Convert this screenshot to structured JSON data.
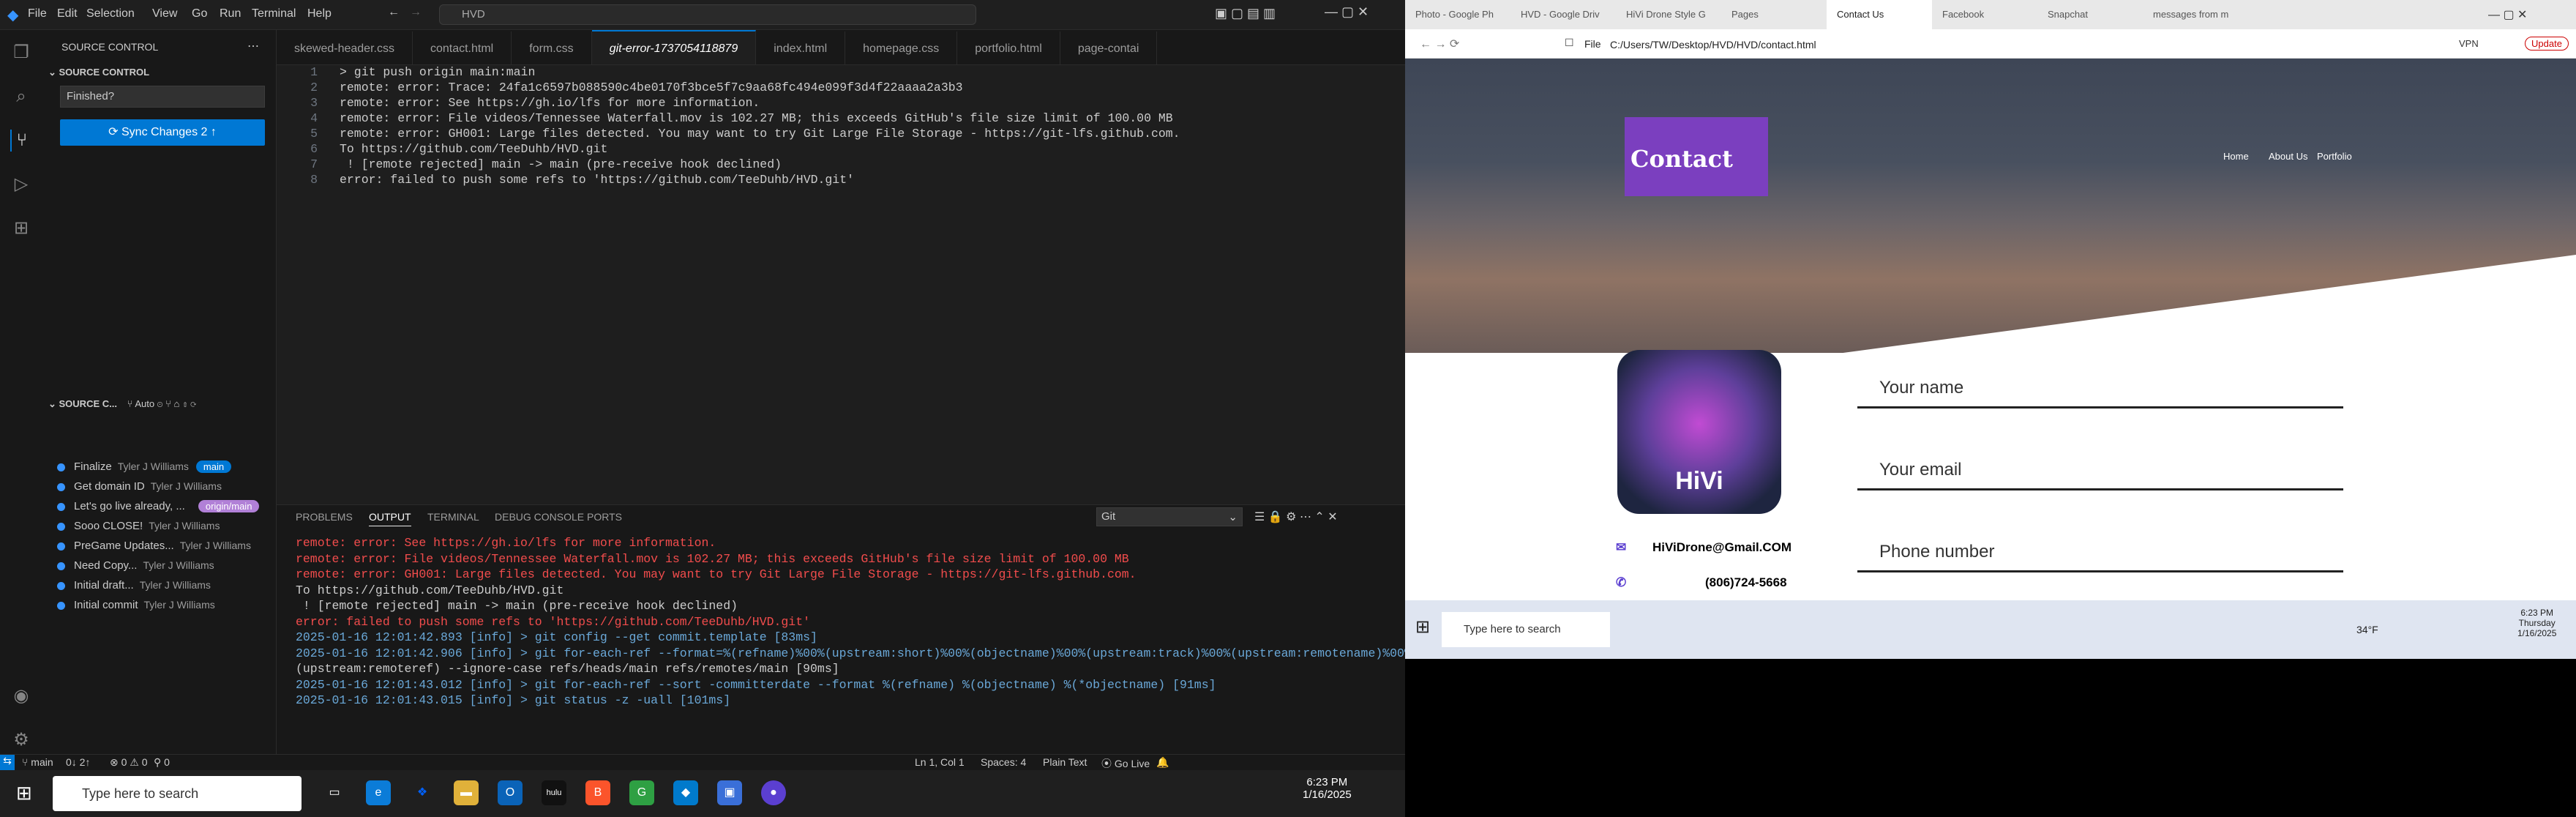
{
  "menu": [
    "File",
    "Edit",
    "Selection",
    "View",
    "Go",
    "Run",
    "Terminal",
    "Help"
  ],
  "command_center": "HVD",
  "sidebar": {
    "title": "SOURCE CONTROL",
    "section": "SOURCE CONTROL",
    "message_placeholder": "Finished?",
    "sync_label": "Sync Changes 2",
    "graph_title": "SOURCE C...",
    "graph_auto": "Auto",
    "commits": [
      {
        "msg": "Finalize",
        "author": "Tyler J Williams",
        "badge": "main"
      },
      {
        "msg": "Get domain ID",
        "author": "Tyler J Williams",
        "badge": ""
      },
      {
        "msg": "Let's go live already, ...",
        "author": "",
        "badge": "origin/main"
      },
      {
        "msg": "Sooo CLOSE!",
        "author": "Tyler J Williams",
        "badge": ""
      },
      {
        "msg": "PreGame Updates...",
        "author": "Tyler J Williams",
        "badge": ""
      },
      {
        "msg": "Need Copy...",
        "author": "Tyler J Williams",
        "badge": ""
      },
      {
        "msg": "Initial draft...",
        "author": "Tyler J Williams",
        "badge": ""
      },
      {
        "msg": "Initial commit",
        "author": "Tyler J Williams",
        "badge": ""
      }
    ]
  },
  "tabs": [
    "skewed-header.css",
    "contact.html",
    "form.css",
    "git-error-1737054118879",
    "index.html",
    "homepage.css",
    "portfolio.html",
    "page-contai"
  ],
  "editor_lines": [
    "> git push origin main:main",
    "remote: error: Trace: 24fa1c6597b088590c4be0170f3bce5f7c9aa68fc494e099f3d4f22aaaa2a3b3",
    "remote: error: See https://gh.io/lfs for more information.",
    "remote: error: File videos/Tennessee Waterfall.mov is 102.27 MB; this exceeds GitHub's file size limit of 100.00 MB",
    "remote: error: GH001: Large files detected. You may want to try Git Large File Storage - https://git-lfs.github.com.",
    "To https://github.com/TeeDuhb/HVD.git",
    " ! [remote rejected] main -> main (pre-receive hook declined)",
    "error: failed to push some refs to 'https://github.com/TeeDuhb/HVD.git'"
  ],
  "panel": {
    "tabs": [
      "PROBLEMS",
      "OUTPUT",
      "TERMINAL",
      "DEBUG CONSOLE",
      "PORTS"
    ],
    "selector": "Git",
    "lines": [
      "remote: error: See https://gh.io/lfs for more information.",
      "remote: error: File videos/Tennessee Waterfall.mov is 102.27 MB; this exceeds GitHub's file size limit of 100.00 MB",
      "remote: error: GH001: Large files detected. You may want to try Git Large File Storage - https://git-lfs.github.com.",
      "To https://github.com/TeeDuhb/HVD.git",
      " ! [remote rejected] main -> main (pre-receive hook declined)",
      "error: failed to push some refs to 'https://github.com/TeeDuhb/HVD.git'",
      "2025-01-16 12:01:42.893 [info] > git config --get commit.template [83ms]",
      "2025-01-16 12:01:42.906 [info] > git for-each-ref --format=%(refname)%00%(upstream:short)%00%(objectname)%00%(upstream:track)%00%(upstream:remotename)%00%",
      "(upstream:remoteref) --ignore-case refs/heads/main refs/remotes/main [90ms]",
      "2025-01-16 12:01:43.012 [info] > git for-each-ref --sort -committerdate --format %(refname) %(objectname) %(*objectname) [91ms]",
      "2025-01-16 12:01:43.015 [info] > git status -z -uall [101ms]"
    ]
  },
  "status": {
    "branch": "main",
    "sync": "0↓ 2↑",
    "problems": "⊗ 0 ⚠ 0",
    "ports": "⚲ 0",
    "position": "Ln 1, Col 1",
    "spaces": "Spaces: 4",
    "lang": "Plain Text",
    "golive": "Go Live"
  },
  "taskbar": {
    "search": "Type here to search",
    "time": "6:23 PM",
    "date": "1/16/2025"
  },
  "browser": {
    "tabs": [
      "Photo - Google Ph",
      "HVD - Google Driv",
      "HiVi Drone Style G",
      "Pages",
      "Contact Us",
      "Facebook",
      "Snapchat",
      "messages from m"
    ],
    "url": "C:/Users/TW/Desktop/HVD/HVD/contact.html",
    "file_label": "File",
    "vpn": "VPN",
    "update": "Update",
    "page": {
      "logo": "Contact",
      "nav": [
        "Home",
        "About Us",
        "Portfolio"
      ],
      "avatar_text": "HiVi",
      "fields": [
        "Your name",
        "Your email",
        "Phone number"
      ],
      "email": "HiViDrone@Gmail.COM",
      "phone": "(806)724-5668"
    }
  },
  "btask": {
    "search": "Type here to search",
    "temp": "34°F",
    "time": "6:23 PM",
    "day": "Thursday",
    "date": "1/16/2025"
  }
}
